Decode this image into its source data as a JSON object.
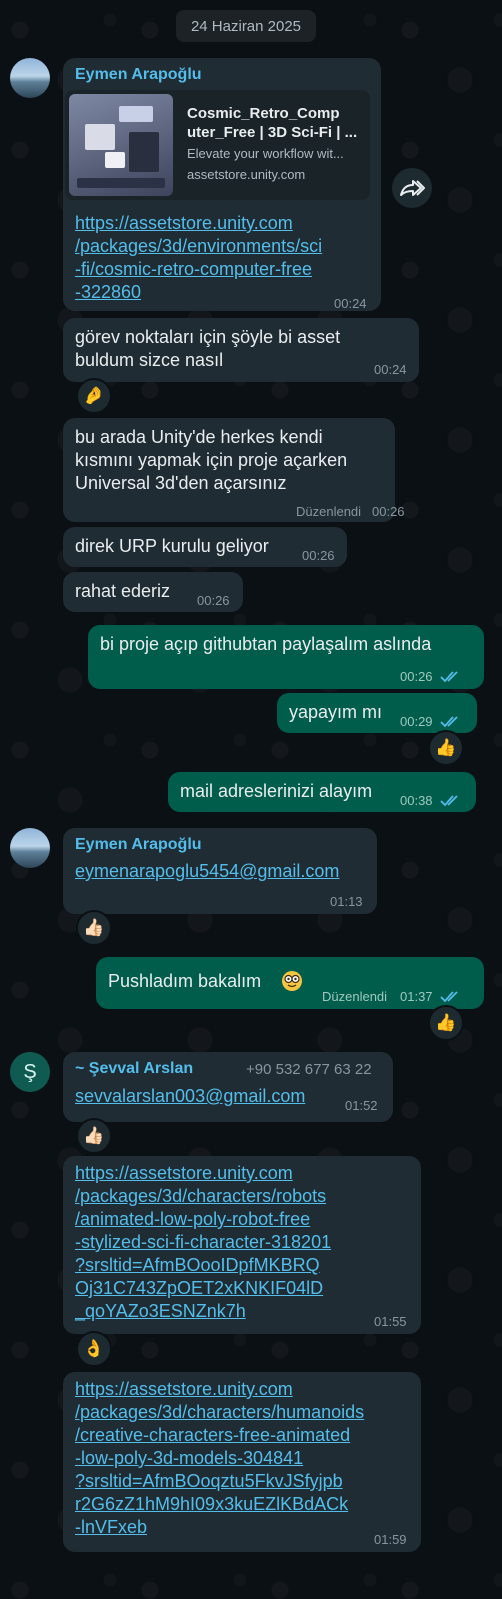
{
  "date_divider": "24 Haziran 2025",
  "messages": {
    "m1": {
      "sender": "Eymen Arapoğlu",
      "preview_title": "Cosmic_Retro_Comp\nuter_Free | 3D Sci-Fi | ...",
      "preview_desc": "Elevate your workflow wit...",
      "preview_domain": "assetstore.unity.com",
      "link": "https://assetstore.unity.com\n/packages/3d/environments/sci\n-fi/cosmic-retro-computer-free\n-322860",
      "time": "00:24"
    },
    "m2": {
      "text": "görev noktaları için şöyle bi asset\nbuldum sizce nasıl",
      "time": "00:24",
      "reaction": "🤌"
    },
    "m3": {
      "text": "bu arada Unity'de herkes kendi\nkısmını yapmak için proje açarken\nUniversal 3d'den açarsınız",
      "edited": "Düzenlendi",
      "time": "00:26"
    },
    "m4": {
      "text": "direk URP kurulu geliyor",
      "time": "00:26"
    },
    "m5": {
      "text": "rahat ederiz",
      "time": "00:26"
    },
    "m6": {
      "text": "bi proje açıp githubtan paylaşalım aslında",
      "time": "00:26"
    },
    "m7": {
      "text": "yapayım mı",
      "time": "00:29",
      "reaction": "👍"
    },
    "m8": {
      "text": "mail adreslerinizi alayım",
      "time": "00:38"
    },
    "m9": {
      "sender": "Eymen Arapoğlu",
      "link": "eymenarapoglu5454@gmail.com",
      "time": "01:13",
      "reaction": "👍🏻"
    },
    "m10": {
      "text": "Pushladım bakalım",
      "edited": "Düzenlendi",
      "time": "01:37",
      "reaction": "👍"
    },
    "m11": {
      "avatar_letter": "Ş",
      "sender": "~ Şevval Arslan",
      "phone": "+90 532 677 63 22",
      "link": "sevvalarslan003@gmail.com",
      "time": "01:52",
      "reaction": "👍🏻"
    },
    "m12": {
      "link": "https://assetstore.unity.com\n/packages/3d/characters/robots\n/animated-low-poly-robot-free\n-stylized-sci-fi-character-318201\n?srsltid=AfmBOooIDpfMKBRQ\nOj31C743ZpOET2xKNKIF04lD\n_qoYAZo3ESNZnk7h",
      "time": "01:55",
      "reaction": "👌"
    },
    "m13": {
      "link": "https://assetstore.unity.com\n/packages/3d/characters/humanoids\n/creative-characters-free-animated\n-low-poly-3d-models-304841\n?srsltid=AfmBOoqztu5FkvJSfyjpb\nr2G6zZ1hM9hI09x3kuEZlKBdACk\n-lnVFxeb",
      "time": "01:59"
    }
  },
  "colors": {
    "incoming_bubble": "#202c33",
    "outgoing_bubble": "#005c4b",
    "link": "#53bdeb",
    "read_ticks": "#53bdeb",
    "background": "#0b1014"
  }
}
